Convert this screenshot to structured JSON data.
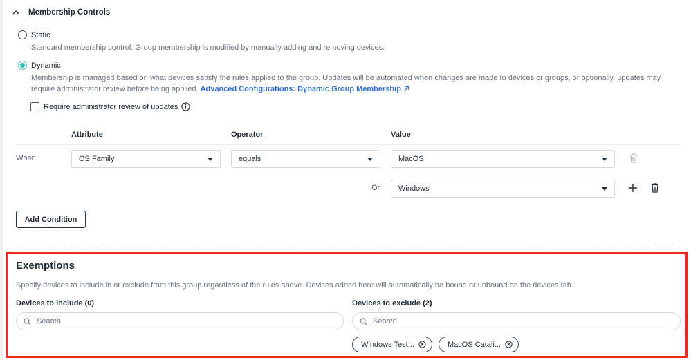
{
  "membership": {
    "title": "Membership Controls",
    "options": [
      {
        "label": "Static",
        "checked": false,
        "description": "Standard membership control. Group membership is modified by manually adding and removing devices."
      },
      {
        "label": "Dynamic",
        "checked": true,
        "description": "Membership is managed based on what devices satisfy the rules applied to the group. Updates will be automated when changes are made to devices or groups, or optionally, updates may require administrator review before being applied.",
        "link_text": "Advanced Configurations: Dynamic Group Membership"
      }
    ],
    "review_checkbox": {
      "label": "Require administrator review of updates",
      "checked": false
    }
  },
  "rules": {
    "columns": {
      "attribute": "Attribute",
      "operator": "Operator",
      "value": "Value"
    },
    "rows": [
      {
        "prefix": "When",
        "attribute": "OS Family",
        "operator": "equals",
        "value": "MacOS"
      },
      {
        "prefix": "Or",
        "value": "Windows"
      }
    ],
    "add_condition_label": "Add Condition"
  },
  "exemptions": {
    "title": "Exemptions",
    "description": "Specify devices to include in or exclude from this group regardless of the rules above. Devices added here will automatically be bound or unbound on the devices tab.",
    "include": {
      "label": "Devices to include (0)",
      "placeholder": "Search",
      "value": ""
    },
    "exclude": {
      "label": "Devices to exclude (2)",
      "placeholder": "Search",
      "value": "",
      "chips": [
        "Windows Test...",
        "MacOS Catali..."
      ]
    }
  },
  "colors": {
    "accent": "#2ec4b6",
    "link": "#2f6fd6",
    "highlight": "#f2261b"
  }
}
